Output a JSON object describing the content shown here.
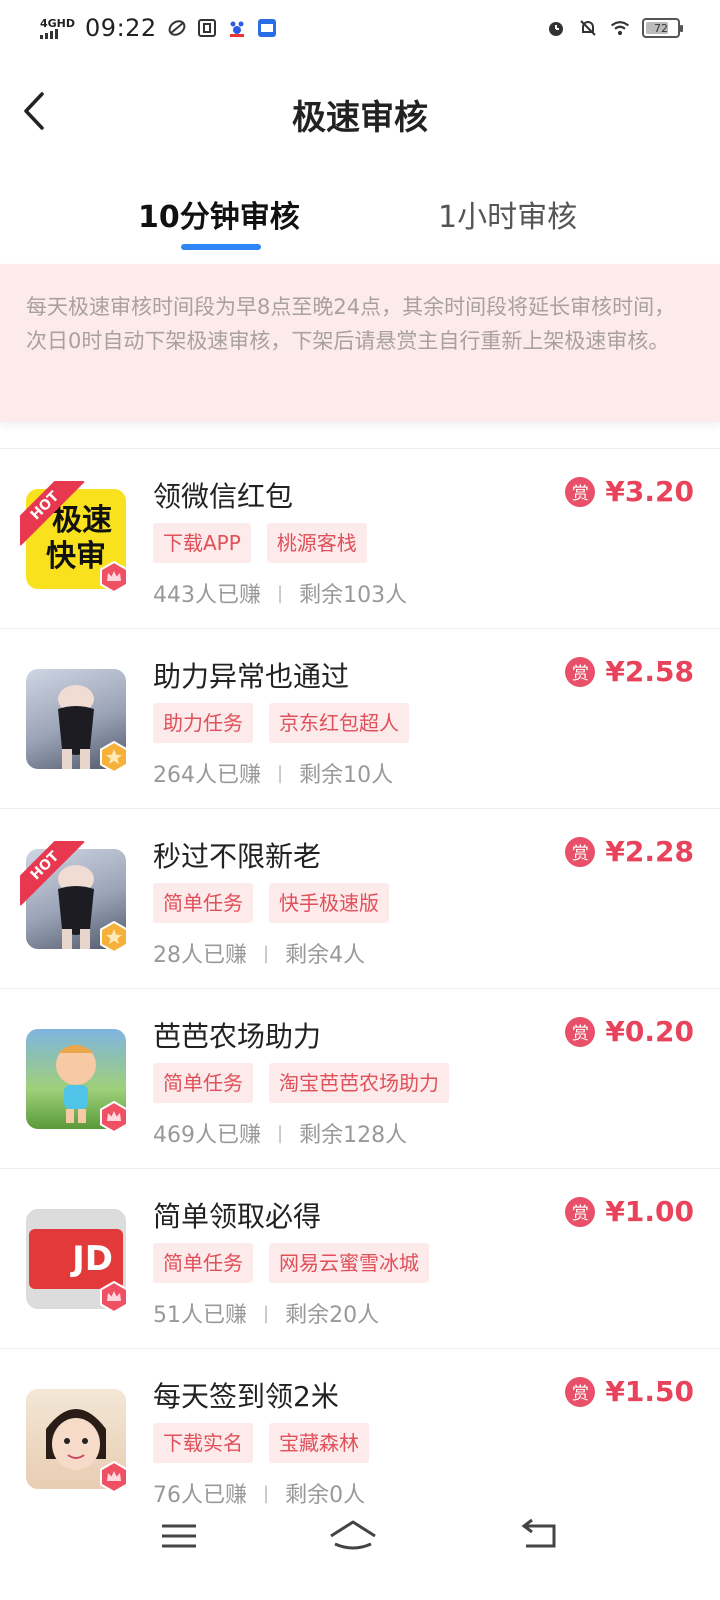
{
  "status_bar": {
    "network": "4GHD",
    "time": "09:22",
    "battery": "72",
    "battery_level": 0.72
  },
  "header": {
    "title": "极速审核"
  },
  "tabs": [
    {
      "label": "10分钟审核",
      "active": true
    },
    {
      "label": "1小时审核",
      "active": false
    }
  ],
  "notice": "每天极速审核时间段为早8点至晚24点，其余时间段将延长审核时间，次日0时自动下架极速审核，下架后请悬赏主自行重新上架极速审核。",
  "tasks": [
    {
      "title": "领微信红包",
      "tags": [
        "下载APP",
        "桃源客栈"
      ],
      "earned": "443人已赚",
      "remaining": "剩余103人",
      "reward_icon": "赏",
      "price": "¥3.20",
      "avatar_text_1": "极速",
      "avatar_text_2": "快审",
      "hot_label": "HOT"
    },
    {
      "title": "助力异常也通过",
      "tags": [
        "助力任务",
        "京东红包超人"
      ],
      "earned": "264人已赚",
      "remaining": "剩余10人",
      "reward_icon": "赏",
      "price": "¥2.58"
    },
    {
      "title": "秒过不限新老",
      "tags": [
        "简单任务",
        "快手极速版"
      ],
      "earned": "28人已赚",
      "remaining": "剩余4人",
      "reward_icon": "赏",
      "price": "¥2.28",
      "hot_label": "HOT"
    },
    {
      "title": "芭芭农场助力",
      "tags": [
        "简单任务",
        "淘宝芭芭农场助力"
      ],
      "earned": "469人已赚",
      "remaining": "剩余128人",
      "reward_icon": "赏",
      "price": "¥0.20"
    },
    {
      "title": "简单领取必得",
      "tags": [
        "简单任务",
        "网易云蜜雪冰城"
      ],
      "earned": "51人已赚",
      "remaining": "剩余20人",
      "reward_icon": "赏",
      "price": "¥1.00",
      "avatar_text_1": "JD"
    },
    {
      "title": "每天签到领2米",
      "tags": [
        "下载实名",
        "宝藏森林"
      ],
      "earned": "76人已赚",
      "remaining": "剩余0人",
      "reward_icon": "赏",
      "price": "¥1.50"
    }
  ],
  "colors": {
    "accent_blue": "#2e86f6",
    "price_red": "#e8435a",
    "tag_bg": "#fdeaea",
    "notice_bg": "#fcebea"
  }
}
